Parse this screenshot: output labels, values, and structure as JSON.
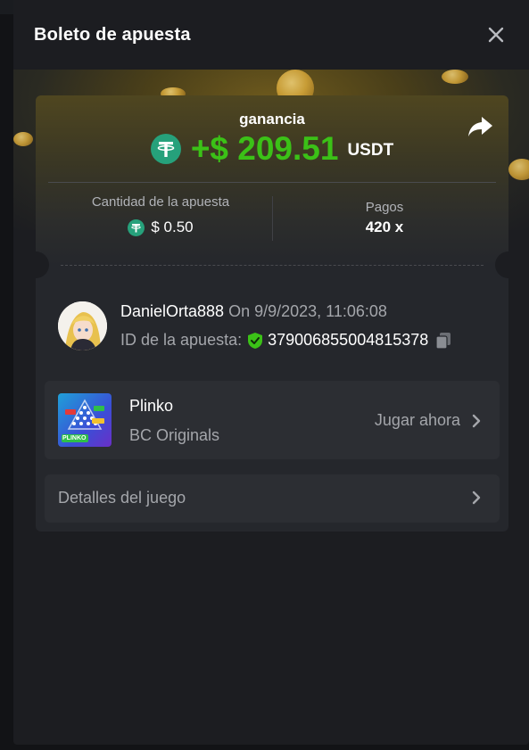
{
  "modal": {
    "title": "Boleto de apuesta"
  },
  "result": {
    "label": "ganancia",
    "amount": "+$ 209.51",
    "currency": "USDT"
  },
  "stats": {
    "bet_amount_label": "Cantidad de la apuesta",
    "bet_amount_value": "$ 0.50",
    "payout_label": "Pagos",
    "payout_value": "420 x"
  },
  "player": {
    "username": "DanielOrta888",
    "datetime": "On 9/9/2023, 11:06:08",
    "bet_id_label": "ID de la apuesta:",
    "bet_id_value": "379006855004815378"
  },
  "game": {
    "name": "Plinko",
    "provider": "BC Originals",
    "play_label": "Jugar ahora",
    "thumb_label": "PLINKO"
  },
  "details": {
    "label": "Detalles del juego"
  },
  "colors": {
    "win_green": "#3bc117",
    "tether": "#26a17b",
    "shield": "#3bc117"
  },
  "icons": {
    "close": "close-icon",
    "share": "share-icon",
    "currency": "tether-icon",
    "verified": "shield-check-icon",
    "copy": "copy-icon",
    "chevron": "chevron-right-icon"
  }
}
